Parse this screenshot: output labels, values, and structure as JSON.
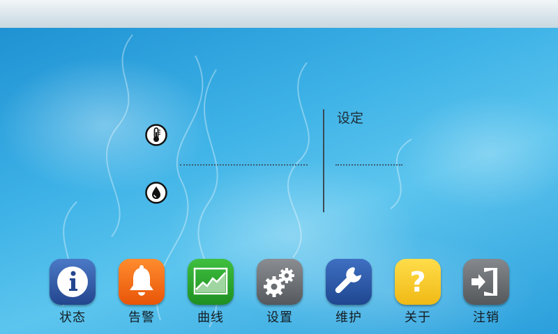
{
  "readings": {
    "setting_label": "设定"
  },
  "sensors": [
    {
      "icon": "thermometer-icon"
    },
    {
      "icon": "water-drop-icon"
    }
  ],
  "dock": [
    {
      "label": "状态",
      "icon": "info-icon",
      "color": "#2e5aa8"
    },
    {
      "label": "告警",
      "icon": "bell-icon",
      "color": "#f06a12"
    },
    {
      "label": "曲线",
      "icon": "chart-icon",
      "color": "#28a52c"
    },
    {
      "label": "设置",
      "icon": "gears-icon",
      "color": "#6f7276"
    },
    {
      "label": "维护",
      "icon": "wrench-icon",
      "color": "#2c58a6"
    },
    {
      "label": "关于",
      "icon": "question-icon",
      "color": "#f5cb2a"
    },
    {
      "label": "注销",
      "icon": "logout-icon",
      "color": "#6c6e71"
    }
  ]
}
